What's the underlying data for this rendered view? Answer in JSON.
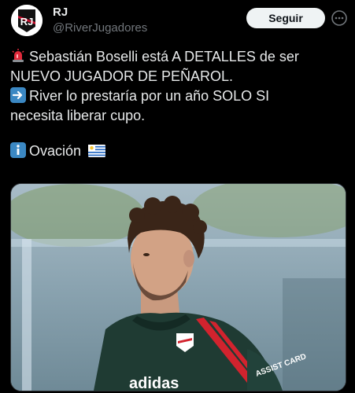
{
  "account": {
    "display_name": "RJ",
    "handle": "@RiverJugadores",
    "avatar_icon": "rj-logo-icon"
  },
  "actions": {
    "follow_label": "Seguir",
    "more_icon": "more-options-icon"
  },
  "tweet": {
    "line1": "Sebastián Boselli está A DETALLES de ser",
    "line2": "NUEVO JUGADOR DE PEÑAROL.",
    "line3": "River lo prestaría por un año SOLO SI",
    "line4": "necesita liberar cupo.",
    "line5": "Ovación",
    "emojis": [
      "police-light-icon",
      "right-arrow-icon",
      "info-icon",
      "uruguay-flag-icon"
    ]
  },
  "media": {
    "image_icon": "player-photo",
    "jersey_text": "adidas",
    "sponsor_text": "ASSIST CARD"
  },
  "colors": {
    "background": "#000000",
    "text": "#e7e9ea",
    "secondary": "#71767b",
    "button_bg": "#eff3f4",
    "button_text": "#0f1419"
  }
}
